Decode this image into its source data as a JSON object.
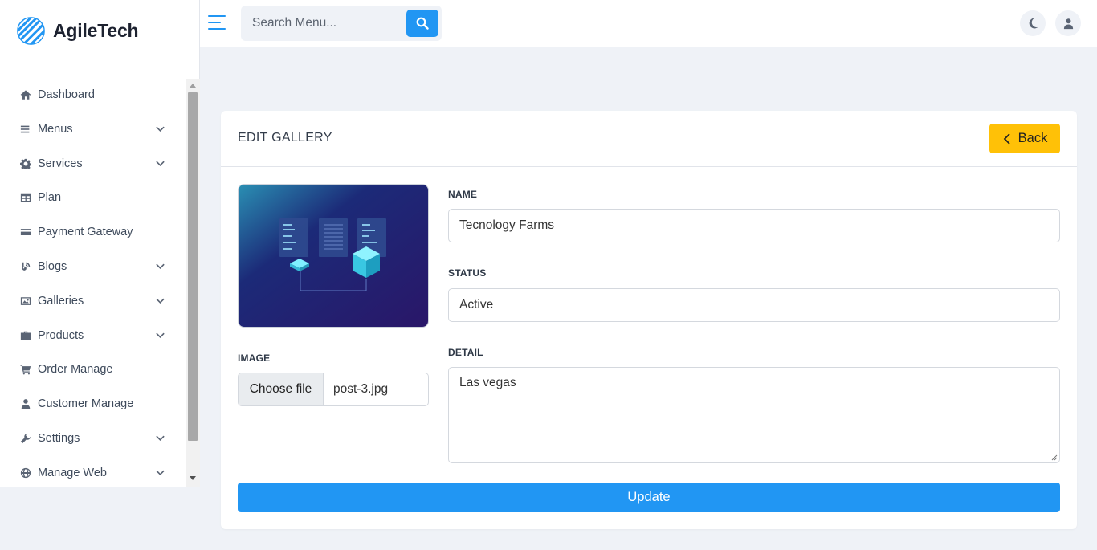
{
  "brand": {
    "name": "AgileTech",
    "logo_icon": "striped-globe-icon",
    "accent": "#2196f3"
  },
  "sidebar": {
    "items": [
      {
        "label": "Dashboard",
        "icon": "home-icon",
        "expandable": false
      },
      {
        "label": "Menus",
        "icon": "list-icon",
        "expandable": true
      },
      {
        "label": "Services",
        "icon": "gear-icon",
        "expandable": true
      },
      {
        "label": "Plan",
        "icon": "table-icon",
        "expandable": false
      },
      {
        "label": "Payment Gateway",
        "icon": "credit-card-icon",
        "expandable": false
      },
      {
        "label": "Blogs",
        "icon": "blog-icon",
        "expandable": true
      },
      {
        "label": "Galleries",
        "icon": "image-icon",
        "expandable": true
      },
      {
        "label": "Products",
        "icon": "briefcase-icon",
        "expandable": true
      },
      {
        "label": "Order Manage",
        "icon": "cart-icon",
        "expandable": false
      },
      {
        "label": "Customer Manage",
        "icon": "user-icon",
        "expandable": false
      },
      {
        "label": "Settings",
        "icon": "wrench-icon",
        "expandable": true
      },
      {
        "label": "Manage Web",
        "icon": "globe-icon",
        "expandable": true
      }
    ]
  },
  "topbar": {
    "search_placeholder": "Search Menu...",
    "search_icon": "search-icon",
    "theme_icon": "moon-icon",
    "user_icon": "user-icon"
  },
  "card": {
    "title": "EDIT GALLERY",
    "back_label": "Back",
    "back_color": "#ffc107",
    "image_label": "IMAGE",
    "file_button_label": "Choose file",
    "file_name": "post-3.jpg",
    "name_label": "NAME",
    "name_value": "Tecnology Farms",
    "status_label": "STATUS",
    "status_value": "Active",
    "detail_label": "DETAIL",
    "detail_value": "Las vegas",
    "update_label": "Update",
    "update_color": "#2196f3"
  }
}
